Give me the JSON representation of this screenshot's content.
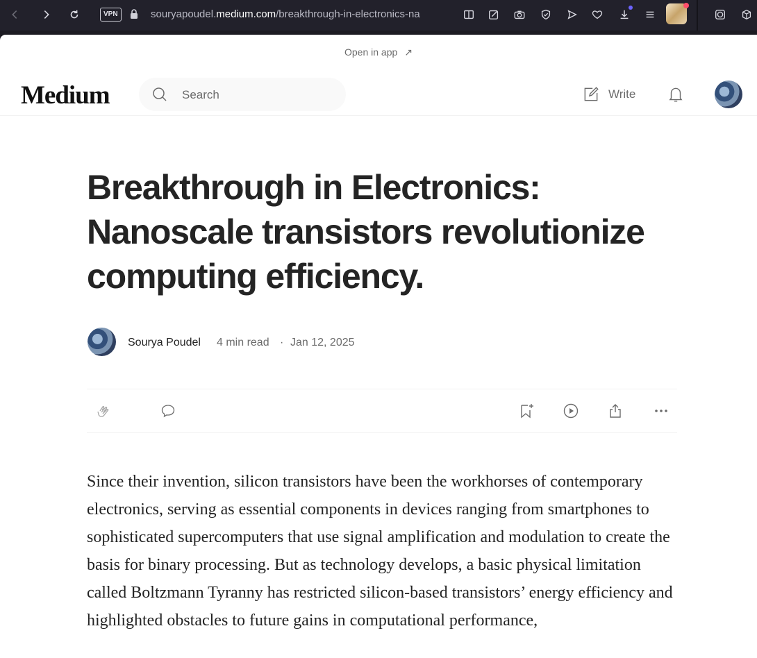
{
  "browser": {
    "vpn_label": "VPN",
    "url_prefix": "souryapoudel.",
    "url_domain": "medium.com",
    "url_path": "/breakthrough-in-electronics-na"
  },
  "page": {
    "open_in_app": "Open in app",
    "open_in_app_arrow": "↗",
    "logo": "Medium",
    "search_placeholder": "Search",
    "write_label": "Write"
  },
  "article": {
    "title": "Breakthrough in Electronics: Nanoscale transistors revolutionize computing efficiency.",
    "author": "Sourya Poudel",
    "read_time": "4 min read",
    "separator": "·",
    "date": "Jan 12, 2025",
    "body": "Since their invention, silicon transistors have been the workhorses of contemporary electronics, serving as essential components in devices ranging from smartphones to sophisticated supercomputers that use signal amplification and modulation to create the basis for binary processing. But as technology develops, a basic physical limitation called Boltzmann Tyranny has restricted silicon-based transistors’ energy efficiency and highlighted obstacles to future gains in computational performance,"
  },
  "icons": {
    "toolbar": [
      "back-icon",
      "forward-icon",
      "reload-icon",
      "lock-icon",
      "reader-view-icon",
      "edit-icon",
      "camera-icon",
      "shield-icon",
      "send-icon",
      "heart-icon",
      "download-icon",
      "menu-icon",
      "profile-avatar",
      "extension-icon",
      "box-icon"
    ],
    "actions": [
      "clap-icon",
      "comment-icon",
      "bookmark-add-icon",
      "listen-icon",
      "share-icon",
      "more-icon"
    ]
  }
}
